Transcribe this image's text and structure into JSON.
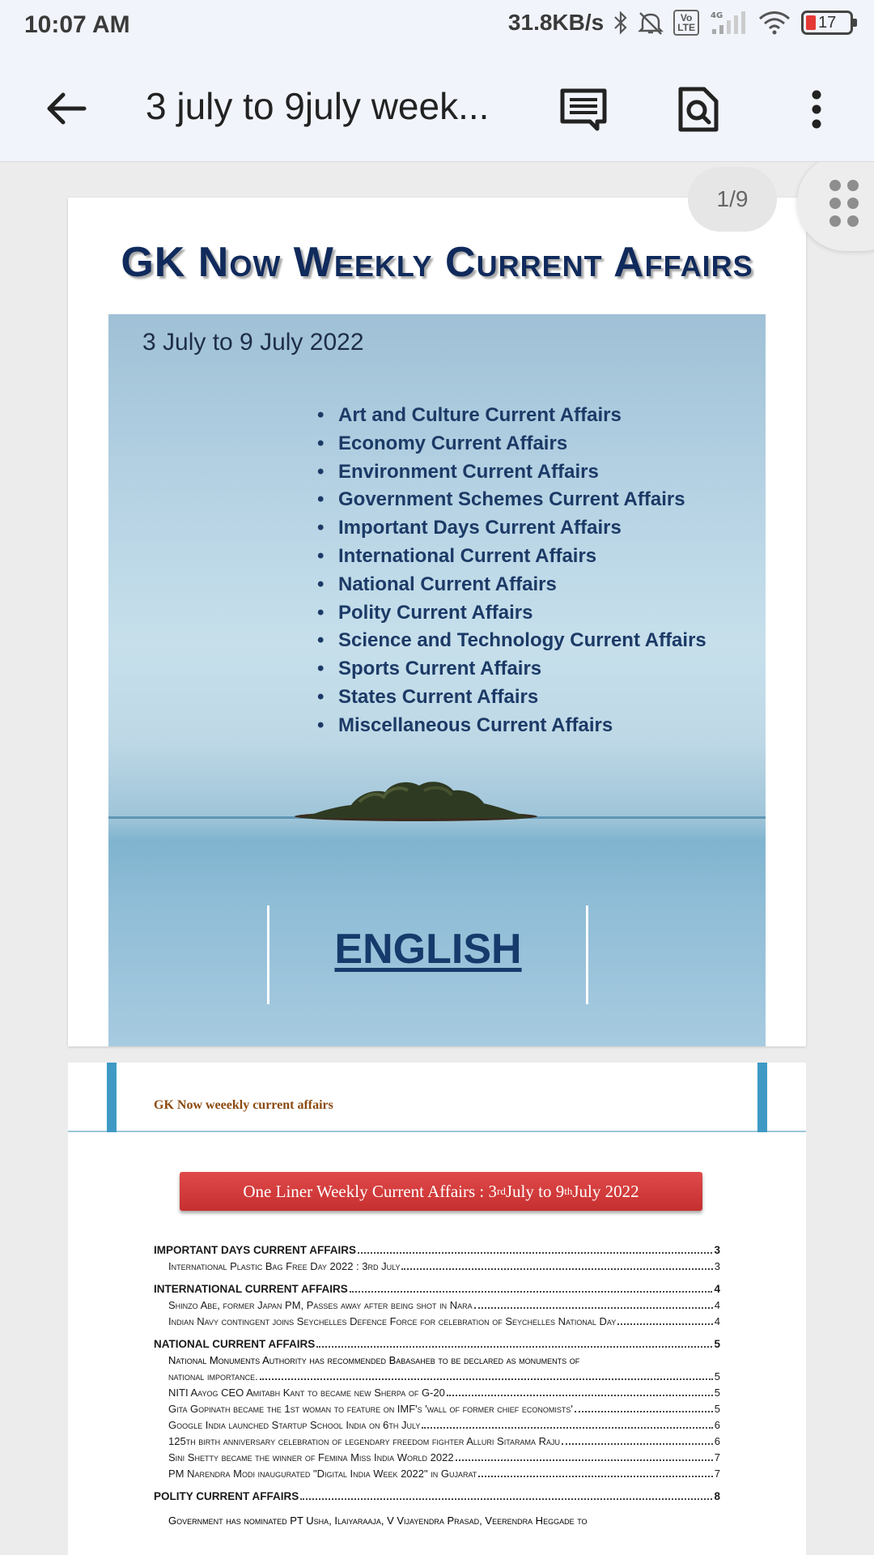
{
  "status_bar": {
    "time": "10:07 AM",
    "net_speed": "31.8KB/s",
    "volte_label": "Vo\nLTE",
    "net_type": "4G",
    "battery": "17",
    "battery_level": 0.17
  },
  "app_bar": {
    "back_icon": "arrow-back-icon",
    "title": "3 july to 9july week...",
    "actions": [
      "comment-icon",
      "find-in-page-icon",
      "more-vert-icon"
    ]
  },
  "viewer": {
    "page_indicator": "1/9",
    "grid_icon": "page-grid-icon"
  },
  "cover": {
    "title": "GK Now Weekly Current Affairs",
    "date": "3 July to 9 July 2022",
    "topics": [
      "Art and Culture Current Affairs",
      "Economy Current Affairs",
      "Environment Current Affairs",
      "Government Schemes Current Affairs",
      "Important Days Current Affairs",
      "International Current Affairs",
      "National Current Affairs",
      "Polity Current Affairs",
      "Science and Technology Current Affairs",
      "Sports Current Affairs",
      "States Current Affairs",
      "Miscellaneous Current Affairs"
    ],
    "language": "ENGLISH"
  },
  "page2": {
    "header": "GK Now weeekly current affairs",
    "banner_pre": "One Liner Weekly Current Affairs : 3",
    "banner_sup1": "rd",
    "banner_mid": " July to 9",
    "banner_sup2": "th",
    "banner_post": " July 2022",
    "toc": [
      {
        "type": "section",
        "label": "IMPORTANT DAYS CURRENT AFFAIRS",
        "page": "3"
      },
      {
        "type": "item",
        "label": "International Plastic Bag Free Day 2022 : 3rd July",
        "page": "3"
      },
      {
        "type": "section",
        "label": "INTERNATIONAL CURRENT AFFAIRS",
        "page": "4"
      },
      {
        "type": "item",
        "label": "Shinzo Abe, former Japan PM, Passes away after being shot in Nara",
        "page": "4"
      },
      {
        "type": "item",
        "label": "Indian Navy contingent joins Seychelles Defence Force for celebration of Seychelles National Day",
        "page": "4"
      },
      {
        "type": "section",
        "label": "NATIONAL CURRENT AFFAIRS",
        "page": "5"
      },
      {
        "type": "item-wrap",
        "label": "National Monuments Authority has recommended Babasaheb to be declared as monuments of",
        "label2": "national importance.",
        "page": "5"
      },
      {
        "type": "item",
        "label": "NITI Aayog CEO Amitabh Kant to became new Sherpa of G-20",
        "page": "5"
      },
      {
        "type": "item",
        "label": "Gita Gopinath became the 1st woman to feature on IMF's 'wall of former chief economists'",
        "page": "5"
      },
      {
        "type": "item",
        "label": "Google India launched Startup School India on 6th July",
        "page": "6"
      },
      {
        "type": "item",
        "label": "125th birth anniversary celebration of legendary freedom fighter Alluri Sitarama Raju",
        "page": "6"
      },
      {
        "type": "item",
        "label": "Sini Shetty became the winner of Femina Miss India World 2022",
        "page": "7"
      },
      {
        "type": "item",
        "label": "PM Narendra Modi inaugurated \"Digital India Week 2022\" in Gujarat",
        "page": "7"
      },
      {
        "type": "section",
        "label": "POLITY CURRENT AFFAIRS",
        "page": "8"
      },
      {
        "type": "text",
        "label": "Government has nominated PT Usha, Ilaiyaraaja, V Vijayendra Prasad, Veerendra Heggade to"
      }
    ]
  }
}
